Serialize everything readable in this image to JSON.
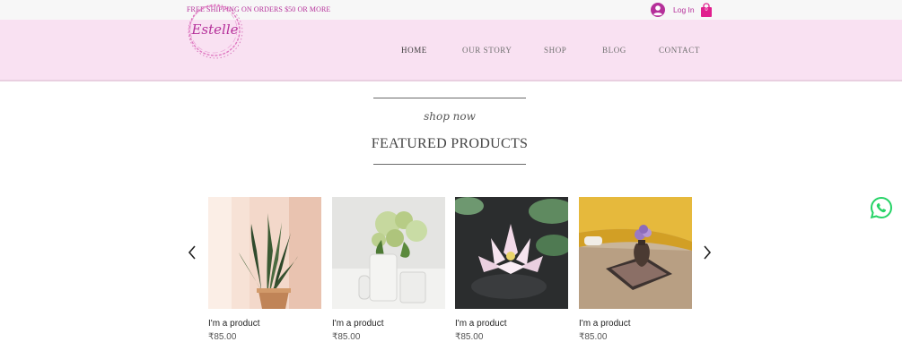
{
  "topbar": {
    "shipping_text": "FREE SHIPPING ON ORDERS $50 OR MORE",
    "login_label": "Log In",
    "cart_count": "0"
  },
  "header": {
    "logo_text": "Estelle",
    "nav": [
      {
        "label": "HOME",
        "active": true
      },
      {
        "label": "OUR STORY",
        "active": false
      },
      {
        "label": "SHOP",
        "active": false
      },
      {
        "label": "BLOG",
        "active": false
      },
      {
        "label": "CONTACT",
        "active": false
      }
    ]
  },
  "section": {
    "kicker": "shop now",
    "title": "FEATURED PRODUCTS"
  },
  "products": [
    {
      "name": "I'm a product",
      "price": "₹85.00",
      "image": "snake-plant-in-pot"
    },
    {
      "name": "I'm a product",
      "price": "₹85.00",
      "image": "hydrangea-in-vase"
    },
    {
      "name": "I'm a product",
      "price": "₹85.00",
      "image": "water-lily"
    },
    {
      "name": "I'm a product",
      "price": "₹85.00",
      "image": "flower-vase-on-mat"
    }
  ],
  "colors": {
    "accent": "#b5309a",
    "header_bg": "#f9e1f2",
    "whatsapp": "#25d366"
  },
  "icons": {
    "user": "user-circle-icon",
    "cart": "shopping-bag-icon",
    "prev": "chevron-left-icon",
    "next": "chevron-right-icon",
    "chat": "whatsapp-icon"
  }
}
